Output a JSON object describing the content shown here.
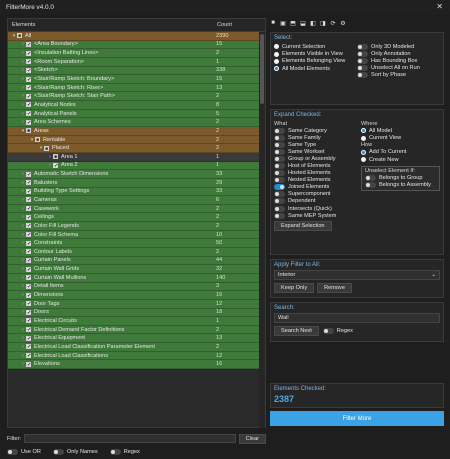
{
  "window": {
    "title": "FilterMore v4.0.0",
    "close_glyph": "✕"
  },
  "table": {
    "headers": {
      "name": "Elements",
      "count": "Count"
    },
    "rows": [
      {
        "indent": 0,
        "chevron": "▾",
        "check": "■",
        "label": "All",
        "count": "2390",
        "style": "orange"
      },
      {
        "indent": 1,
        "chevron": "›",
        "check": "✔",
        "label": "<Area Boundary>",
        "count": "15",
        "style": "green"
      },
      {
        "indent": 1,
        "chevron": "›",
        "check": "✔",
        "label": "<Insulation Batting Lines>",
        "count": "2",
        "style": "green"
      },
      {
        "indent": 1,
        "chevron": "›",
        "check": "✔",
        "label": "<Room Separation>",
        "count": "1",
        "style": "green"
      },
      {
        "indent": 1,
        "chevron": "›",
        "check": "✔",
        "label": "<Sketch>",
        "count": "338",
        "style": "green"
      },
      {
        "indent": 1,
        "chevron": "›",
        "check": "✔",
        "label": "<Stair/Ramp Sketch: Boundary>",
        "count": "15",
        "style": "green"
      },
      {
        "indent": 1,
        "chevron": "›",
        "check": "✔",
        "label": "<Stair/Ramp Sketch: Riser>",
        "count": "13",
        "style": "green"
      },
      {
        "indent": 1,
        "chevron": "›",
        "check": "✔",
        "label": "<Stair/Ramp Sketch: Stair Path>",
        "count": "2",
        "style": "green"
      },
      {
        "indent": 1,
        "chevron": "›",
        "check": "✔",
        "label": "Analytical Nodes",
        "count": "8",
        "style": "green"
      },
      {
        "indent": 1,
        "chevron": "›",
        "check": "✔",
        "label": "Analytical Panels",
        "count": "5",
        "style": "green"
      },
      {
        "indent": 1,
        "chevron": "›",
        "check": "✔",
        "label": "Area Schemes",
        "count": "2",
        "style": "green"
      },
      {
        "indent": 1,
        "chevron": "▾",
        "check": "■",
        "label": "Areas",
        "count": "2",
        "style": "orange"
      },
      {
        "indent": 2,
        "chevron": "▾",
        "check": "■",
        "label": "Rentable",
        "count": "2",
        "style": "orange"
      },
      {
        "indent": 3,
        "chevron": "▾",
        "check": "■",
        "label": "Placed",
        "count": "2",
        "style": "orange"
      },
      {
        "indent": 4,
        "chevron": "›",
        "check": "■",
        "label": "Area 1",
        "count": "1",
        "style": "dark"
      },
      {
        "indent": 4,
        "chevron": "›",
        "check": "✔",
        "label": "Area 2",
        "count": "1",
        "style": "green"
      },
      {
        "indent": 1,
        "chevron": "›",
        "check": "✔",
        "label": "Automatic Sketch Dimensions",
        "count": "33",
        "style": "green"
      },
      {
        "indent": 1,
        "chevron": "›",
        "check": "✔",
        "label": "Balusters",
        "count": "29",
        "style": "green"
      },
      {
        "indent": 1,
        "chevron": "›",
        "check": "✔",
        "label": "Building Type Settings",
        "count": "33",
        "style": "green"
      },
      {
        "indent": 1,
        "chevron": "›",
        "check": "✔",
        "label": "Cameras",
        "count": "6",
        "style": "green"
      },
      {
        "indent": 1,
        "chevron": "›",
        "check": "✔",
        "label": "Casework",
        "count": "2",
        "style": "green"
      },
      {
        "indent": 1,
        "chevron": "›",
        "check": "✔",
        "label": "Ceilings",
        "count": "2",
        "style": "green"
      },
      {
        "indent": 1,
        "chevron": "›",
        "check": "✔",
        "label": "Color Fill Legends",
        "count": "2",
        "style": "green"
      },
      {
        "indent": 1,
        "chevron": "›",
        "check": "✔",
        "label": "Color Fill Schema",
        "count": "10",
        "style": "green"
      },
      {
        "indent": 1,
        "chevron": "›",
        "check": "✔",
        "label": "Constraints",
        "count": "50",
        "style": "green"
      },
      {
        "indent": 1,
        "chevron": "›",
        "check": "✔",
        "label": "Contour Labels",
        "count": "2",
        "style": "green"
      },
      {
        "indent": 1,
        "chevron": "›",
        "check": "✔",
        "label": "Curtain Panels",
        "count": "44",
        "style": "green"
      },
      {
        "indent": 1,
        "chevron": "›",
        "check": "✔",
        "label": "Curtain Wall Grids",
        "count": "32",
        "style": "green"
      },
      {
        "indent": 1,
        "chevron": "›",
        "check": "✔",
        "label": "Curtain Wall Mullions",
        "count": "140",
        "style": "green"
      },
      {
        "indent": 1,
        "chevron": "›",
        "check": "✔",
        "label": "Detail Items",
        "count": "3",
        "style": "green"
      },
      {
        "indent": 1,
        "chevron": "›",
        "check": "✔",
        "label": "Dimensions",
        "count": "16",
        "style": "green"
      },
      {
        "indent": 1,
        "chevron": "›",
        "check": "✔",
        "label": "Door Tags",
        "count": "12",
        "style": "green"
      },
      {
        "indent": 1,
        "chevron": "›",
        "check": "✔",
        "label": "Doors",
        "count": "18",
        "style": "green"
      },
      {
        "indent": 1,
        "chevron": "›",
        "check": "✔",
        "label": "Electrical Circuits",
        "count": "1",
        "style": "green"
      },
      {
        "indent": 1,
        "chevron": "›",
        "check": "✔",
        "label": "Electrical Demand Factor Definitions",
        "count": "2",
        "style": "green"
      },
      {
        "indent": 1,
        "chevron": "›",
        "check": "✔",
        "label": "Electrical Equipment",
        "count": "13",
        "style": "green"
      },
      {
        "indent": 1,
        "chevron": "›",
        "check": "✔",
        "label": "Electrical Load Classification Parameter Element",
        "count": "2",
        "style": "green"
      },
      {
        "indent": 1,
        "chevron": "›",
        "check": "✔",
        "label": "Electrical Load Classifications",
        "count": "12",
        "style": "green"
      },
      {
        "indent": 1,
        "chevron": "›",
        "check": "✔",
        "label": "Elevations",
        "count": "16",
        "style": "green"
      }
    ]
  },
  "filter": {
    "label": "Filter:",
    "value": "",
    "clear_label": "Clear"
  },
  "bottom_options": {
    "use_or": "Use OR",
    "only_names": "Only Names",
    "regex": "Regex"
  },
  "toolbar": {
    "icons": [
      "■",
      "▣",
      "⬒",
      "⬓",
      "◧",
      "◨",
      "⟳",
      "⚙"
    ]
  },
  "select_panel": {
    "title": "Select:",
    "left": [
      "Current Selection",
      "Elements Visible in View",
      "Elements Belonging View",
      "All Model Elements"
    ],
    "right": [
      "Only 3D Modeled",
      "Only Annotation",
      "Has Bounding Box",
      "Unselect All on Run",
      "Sort by Phase"
    ],
    "selected_index": 3
  },
  "expand_panel": {
    "title": "Expand Checked:",
    "what_label": "What",
    "what_items": [
      "Same Category",
      "Same Family",
      "Same Type",
      "Same Workset",
      "Group or Assembly",
      "Host of Elements",
      "Hosted Elements",
      "Nested Elements",
      "Joined Elements",
      "Supercomponent",
      "Dependent",
      "Intersects (Quick)",
      "Same MEP System"
    ],
    "on_index": 8,
    "where_label": "Where",
    "where_items": [
      "All Model",
      "Current View"
    ],
    "where_selected": 0,
    "how_label": "How",
    "how_items": [
      "Add To Current",
      "Create New"
    ],
    "how_selected": 0,
    "unselect_title": "Unselect Element If:",
    "unselect_items": [
      "Belongs to Group",
      "Belongs to Assembly"
    ],
    "button": "Expand Selection"
  },
  "apply_panel": {
    "title": "Apply Filter to All:",
    "selected": "Interior",
    "chevron": "⌄",
    "keep_only": "Keep Only",
    "remove": "Remove"
  },
  "search_panel": {
    "title": "Search:",
    "value": "Wall",
    "search_next": "Search Next",
    "regex": "Regex"
  },
  "checked": {
    "label": "Elements Checked:",
    "value": "2387"
  },
  "main_button": "Filter More"
}
